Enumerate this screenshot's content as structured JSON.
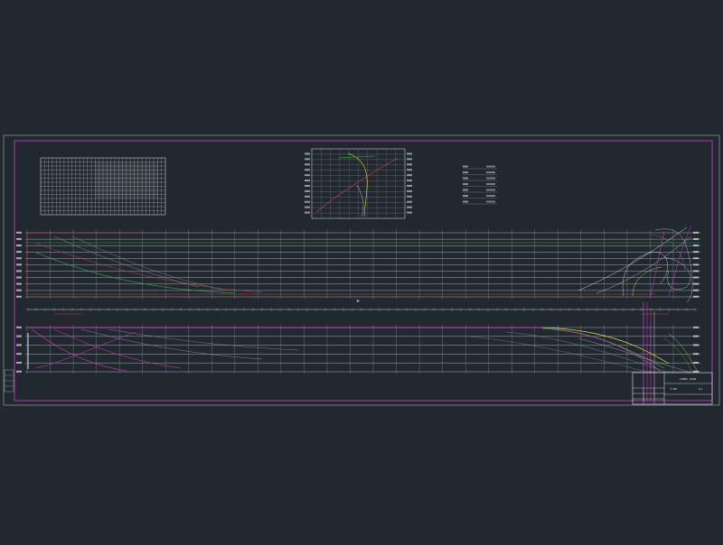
{
  "viewport": {
    "background": "#212830"
  },
  "colors": {
    "sheet_frame": "#8a8f96",
    "magenta": "#d23cd2",
    "white": "#e6e6e6",
    "grey": "#9aa0a6",
    "red": "#d84040",
    "green": "#3cbf4c",
    "yellow": "#e6e03a",
    "cyan": "#37b8c8"
  },
  "drawing": {
    "body_plan_label": "BODY PLAN",
    "offset_table_label": "OFFSETS",
    "hydro_label": "HYDRO",
    "profile_label": "PROFILE",
    "half_breadth_label": "HALF BREADTH",
    "midship_symbol": "⊕",
    "aft_label": "AFT",
    "fwd_label": "FWD"
  },
  "title_block": {
    "title": "LINES PLAN",
    "rows": [
      "",
      "",
      "",
      ""
    ],
    "scale_label": "1:100",
    "sheet_label": "1/1"
  },
  "legend": {
    "rows": [
      "",
      "",
      "",
      "",
      "",
      "",
      ""
    ]
  }
}
